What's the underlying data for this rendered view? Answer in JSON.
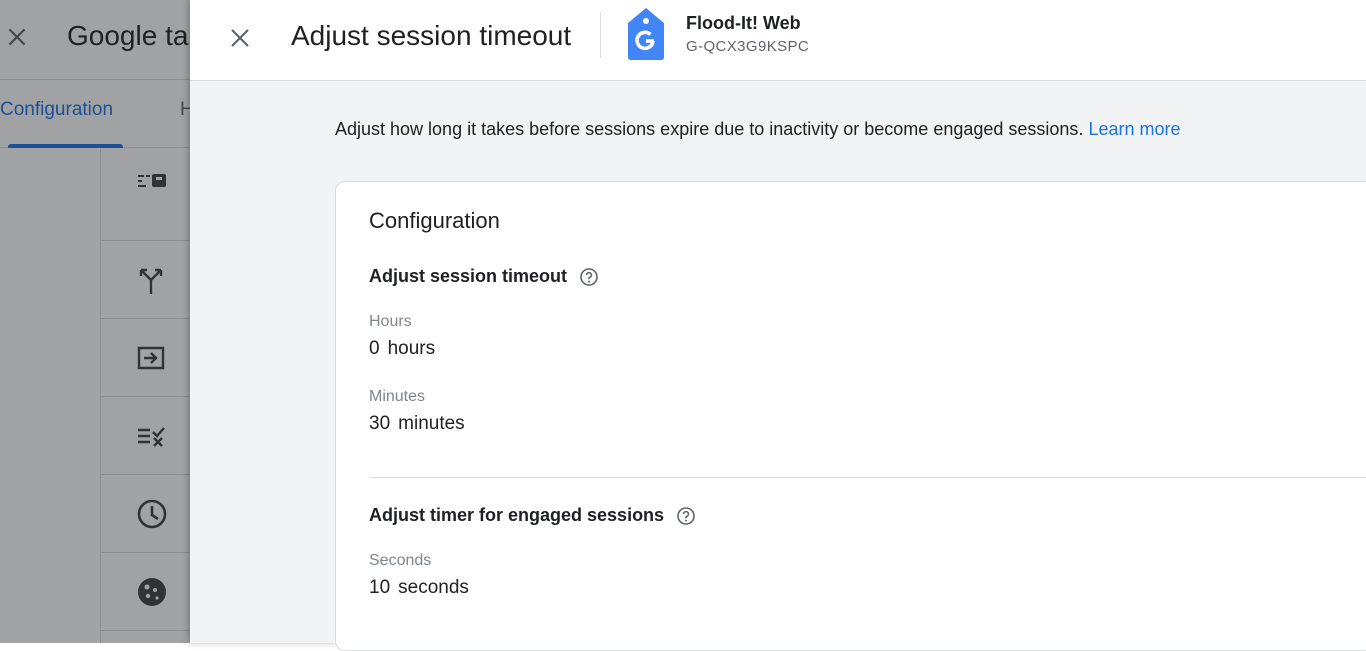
{
  "background": {
    "title": "Google ta",
    "tabs": [
      "Configuration",
      "H"
    ]
  },
  "panel": {
    "title": "Adjust session timeout",
    "stream_name": "Flood-It! Web",
    "stream_id": "G-QCX3G9KSPC",
    "description": "Adjust how long it takes before sessions expire due to inactivity or become engaged sessions.",
    "learn_more": "Learn more"
  },
  "card": {
    "title": "Configuration",
    "session_timeout": {
      "title": "Adjust session timeout",
      "hours_label": "Hours",
      "hours_value": "0",
      "hours_unit": "hours",
      "minutes_label": "Minutes",
      "minutes_value": "30",
      "minutes_unit": "minutes"
    },
    "engaged": {
      "title": "Adjust timer for engaged sessions",
      "seconds_label": "Seconds",
      "seconds_value": "10",
      "seconds_unit": "seconds"
    }
  },
  "colors": {
    "accent": "#1a73e8",
    "tag_icon": "#4285f4"
  },
  "icons": [
    "close-icon",
    "tag-icon",
    "help-circle-icon",
    "filter-icon",
    "fork-icon",
    "login-icon",
    "list-check-icon",
    "clock-icon",
    "cookie-icon"
  ]
}
